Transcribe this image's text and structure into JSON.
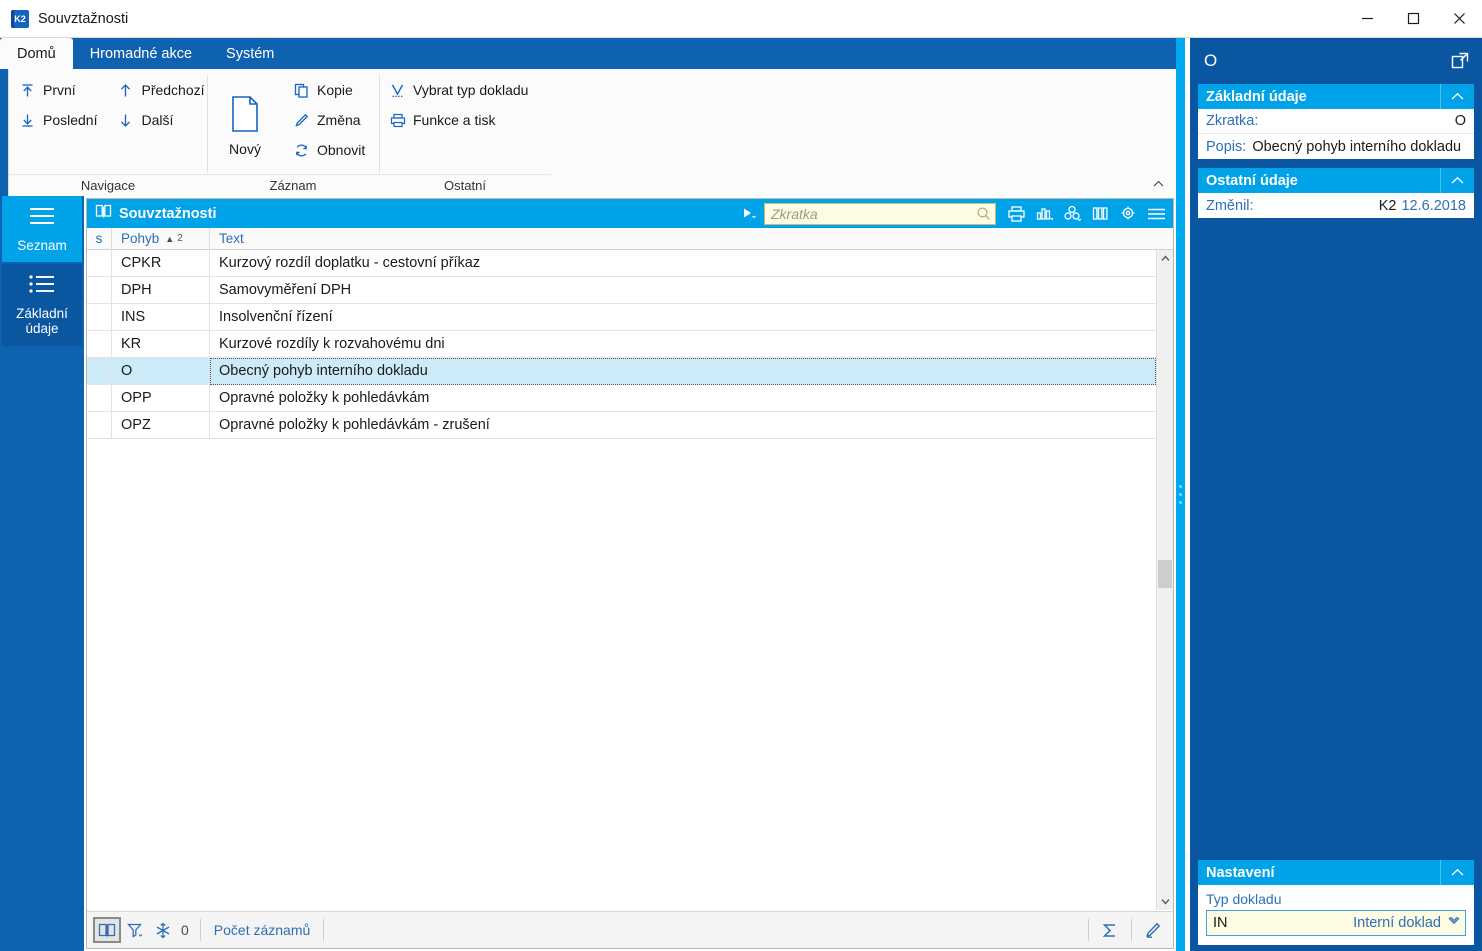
{
  "window": {
    "title": "Souvztažnosti",
    "app_icon": "k2-app-icon",
    "minimize": "–",
    "maximize": "□",
    "close": "✕"
  },
  "ribbon": {
    "tabs": [
      {
        "label": "Domů",
        "active": true
      },
      {
        "label": "Hromadné akce",
        "active": false
      },
      {
        "label": "Systém",
        "active": false
      }
    ],
    "groups": [
      {
        "label": "Navigace",
        "items": [
          {
            "label": "První",
            "icon": "arrow-up-to-line-icon"
          },
          {
            "label": "Poslední",
            "icon": "arrow-down-to-line-icon"
          },
          {
            "label": "Předchozí",
            "icon": "arrow-up-icon"
          },
          {
            "label": "Další",
            "icon": "arrow-down-icon"
          }
        ]
      },
      {
        "label": "Záznam",
        "big": {
          "label": "Nový",
          "icon": "new-document-icon"
        },
        "items": [
          {
            "label": "Kopie",
            "icon": "copy-icon"
          },
          {
            "label": "Změna",
            "icon": "pencil-icon"
          },
          {
            "label": "Obnovit",
            "icon": "refresh-icon"
          }
        ]
      },
      {
        "label": "Ostatní",
        "items": [
          {
            "label": "Vybrat typ dokladu",
            "icon": "select-type-icon"
          },
          {
            "label": "Funkce a tisk",
            "icon": "printer-icon"
          }
        ]
      }
    ],
    "collapse_icon": "chevron-up-icon"
  },
  "leftnav": {
    "items": [
      {
        "label": "Seznam",
        "icon": "list-lines-icon",
        "state": "active"
      },
      {
        "label": "Základní údaje",
        "icon": "list-bullets-icon",
        "state": "selected"
      }
    ]
  },
  "grid": {
    "title": "Souvztažnosti",
    "title_icon": "book-icon",
    "filter_icon": "play-filter-icon",
    "search": {
      "placeholder": "Zkratka",
      "value": "",
      "icon": "magnifier-icon"
    },
    "tool_icons": [
      "printer-icon",
      "bar-chart-icon",
      "pivot-cube-icon",
      "columns-icon",
      "gear-icon",
      "hamburger-menu-icon"
    ],
    "columns": [
      {
        "key": "s",
        "label": "s"
      },
      {
        "key": "pohyb",
        "label": "Pohyb",
        "sort": "▲",
        "sort_index": "2"
      },
      {
        "key": "text",
        "label": "Text"
      }
    ],
    "rows": [
      {
        "s": "",
        "pohyb": "CPKR",
        "text": "Kurzový rozdíl doplatku - cestovní příkaz",
        "selected": false
      },
      {
        "s": "",
        "pohyb": "DPH",
        "text": "Samovyměření DPH",
        "selected": false
      },
      {
        "s": "",
        "pohyb": "INS",
        "text": "Insolvenční řízení",
        "selected": false
      },
      {
        "s": "",
        "pohyb": "KR",
        "text": "Kurzové rozdíly k rozvahovému dni",
        "selected": false
      },
      {
        "s": "",
        "pohyb": "O",
        "text": "Obecný pohyb interního dokladu",
        "selected": true
      },
      {
        "s": "",
        "pohyb": "OPP",
        "text": "Opravné položky k pohledávkám",
        "selected": false
      },
      {
        "s": "",
        "pohyb": "OPZ",
        "text": "Opravné položky k pohledávkám - zrušení",
        "selected": false
      }
    ],
    "status": {
      "book_icon": "book-open-icon",
      "filter_icon": "funnel-icon",
      "freeze_icon": "snowflake-icon",
      "count": "0",
      "count_label": "Počet záznamů",
      "sum_icon": "sigma-icon",
      "edit_icon": "pencil-icon"
    },
    "scrollbar": {
      "up_icon": "chevron-up-icon",
      "down_icon": "chevron-down-icon"
    }
  },
  "rightpanel": {
    "header": {
      "title": "O",
      "expand_icon": "open-external-icon"
    },
    "sections": [
      {
        "title": "Základní údaje",
        "chevron": "chevron-up-icon",
        "rows": [
          {
            "label": "Zkratka:",
            "value": "O",
            "align": "right"
          },
          {
            "label": "Popis:",
            "value": "Obecný pohyb interního dokladu",
            "align": "left"
          }
        ]
      },
      {
        "title": "Ostatní údaje",
        "chevron": "chevron-up-icon",
        "rows": [
          {
            "label": "Změnil:",
            "value": "K2",
            "value2": "12.6.2018",
            "align": "right"
          }
        ]
      }
    ],
    "nastaveni": {
      "title": "Nastavení",
      "chevron": "chevron-up-icon",
      "field_label": "Typ dokladu",
      "field_code": "IN",
      "field_desc": "Interní doklad",
      "field_chevron": "double-chevron-down-icon"
    }
  },
  "colors": {
    "ribbon_blue": "#0f62b0",
    "accent_cyan": "#00a2e8",
    "panel_blue": "#0a56a0",
    "selected_row": "#cdeaf9",
    "link_blue": "#2f6fb5",
    "field_yellow": "#fdfbe2"
  }
}
